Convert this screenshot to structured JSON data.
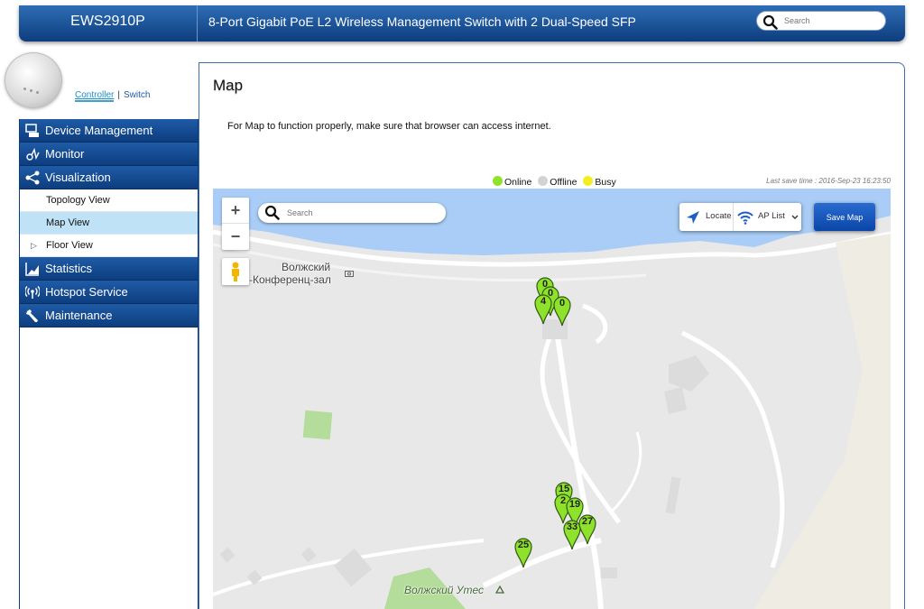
{
  "header": {
    "model": "EWS2910P",
    "description": "8-Port Gigabit PoE L2 Wireless Management Switch with 2 Dual-Speed SFP",
    "search_placeholder": "Search"
  },
  "mode_switch": {
    "controller": "Controller",
    "separator": "|",
    "switch": "Switch"
  },
  "sidebar": {
    "items": [
      {
        "label": "Device Management",
        "icon": "device-management-icon"
      },
      {
        "label": "Monitor",
        "icon": "monitor-icon"
      },
      {
        "label": "Visualization",
        "icon": "share-icon"
      },
      {
        "label": "Topology View"
      },
      {
        "label": "Map View"
      },
      {
        "label": "Floor View"
      },
      {
        "label": "Statistics",
        "icon": "bar-chart-icon"
      },
      {
        "label": "Hotspot Service",
        "icon": "wireless-icon"
      },
      {
        "label": "Maintenance",
        "icon": "wrench-icon"
      }
    ]
  },
  "main": {
    "title": "Map",
    "notice": "For Map to function properly, make sure that browser can access internet.",
    "legend": {
      "online": "Online",
      "offline": "Offline",
      "busy": "Busy",
      "online_color": "#8fe22b",
      "offline_color": "#d3d3d3",
      "busy_color": "#f2ee21"
    },
    "last_save": "Last save time : 2016-Sep-23 16:23:50"
  },
  "map": {
    "search_placeholder": "Search",
    "zoom_in": "+",
    "zoom_out": "−",
    "locate": "Locate",
    "ap_list": "AP List",
    "save_map": "Save Map",
    "labels": {
      "place1_line1": "Волжский",
      "place1_line2": "-Конференц-зал",
      "place2": "Волжский Утес"
    },
    "markers": [
      {
        "label": "0"
      },
      {
        "label": "0"
      },
      {
        "label": "4"
      },
      {
        "label": "0"
      },
      {
        "label": "15"
      },
      {
        "label": "2"
      },
      {
        "label": "19"
      },
      {
        "label": "33"
      },
      {
        "label": "27"
      },
      {
        "label": "25"
      }
    ]
  }
}
